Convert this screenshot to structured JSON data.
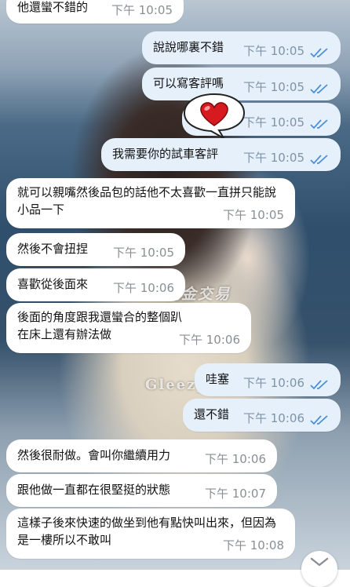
{
  "watermark": {
    "line1": "現金交易",
    "line2": "Gleezy"
  },
  "messages": [
    {
      "side": "in",
      "text": "他還蠻不錯的",
      "time": "下午 10:05"
    },
    {
      "side": "out",
      "text": "說說哪裏不錯",
      "time": "下午 10:05"
    },
    {
      "side": "out",
      "text": "可以寫客評嗎",
      "time": "下午 10:05"
    },
    {
      "side": "out",
      "text": "",
      "time": "下午 10:05"
    },
    {
      "side": "out",
      "text": "我需要你的試車客評",
      "time": "下午 10:05"
    },
    {
      "side": "in",
      "text": "就可以親嘴然後品包的話他不太喜歡一直拼只能說小品一下",
      "time": "下午 10:05"
    },
    {
      "side": "in",
      "text": "然後不會扭捏",
      "time": "下午 10:05"
    },
    {
      "side": "in",
      "text": "喜歡從後面來",
      "time": "下午 10:06"
    },
    {
      "side": "in",
      "text": "後面的角度跟我還蠻合的整個趴在床上還有辦法做",
      "time": "下午 10:06"
    },
    {
      "side": "out",
      "text": "哇塞",
      "time": "下午 10:06"
    },
    {
      "side": "out",
      "text": "還不錯",
      "time": "下午 10:06"
    },
    {
      "side": "in",
      "text": "然後很耐做。會叫你繼續用力",
      "time": "下午 10:06"
    },
    {
      "side": "in",
      "text": "跟他做一直都在很堅挺的狀態",
      "time": "下午 10:07"
    },
    {
      "side": "in",
      "text": "這樣子後來快速的做坐到他有點快叫出來，但因為是一樓所以不敢叫",
      "time": "下午 10:08"
    }
  ],
  "icons": {
    "read_receipt": "double-check-icon",
    "sticker": "heart-icon",
    "scroll": "chevron-down-icon"
  },
  "colors": {
    "incoming": "#ffffff",
    "outgoing": "#e6f0fb",
    "check": "#4a90d9"
  }
}
